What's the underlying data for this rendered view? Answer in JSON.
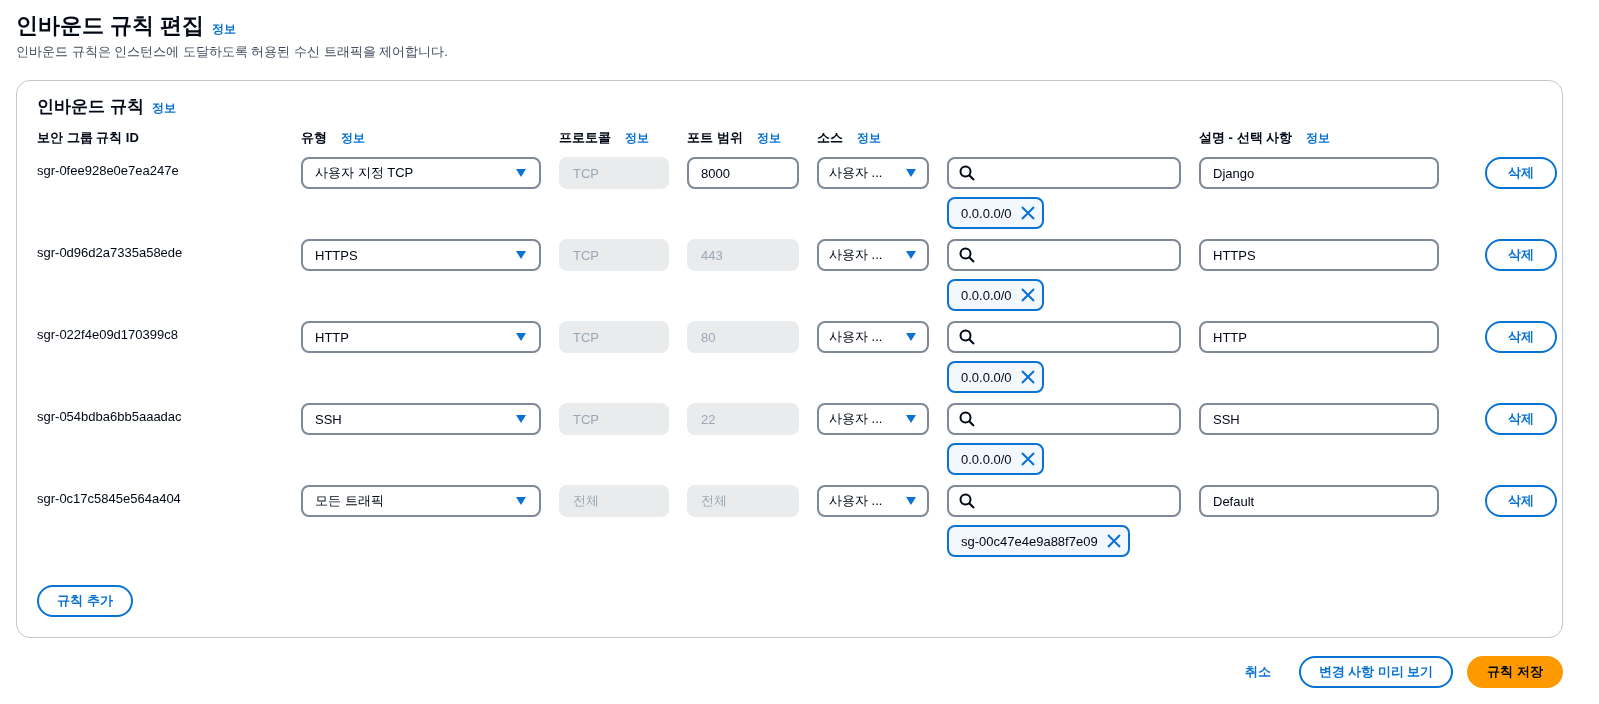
{
  "page": {
    "title": "인바운드 규칙 편집",
    "info": "정보",
    "description": "인바운드 규칙은 인스턴스에 도달하도록 허용된 수신 트래픽을 제어합니다."
  },
  "card": {
    "title": "인바운드 규칙",
    "info": "정보"
  },
  "columns": [
    {
      "label": "보안 그룹 규칙 ID"
    },
    {
      "label": "유형",
      "info": "정보"
    },
    {
      "label": "프로토콜",
      "info": "정보"
    },
    {
      "label": "포트 범위",
      "info": "정보"
    },
    {
      "label": "소스",
      "info": "정보"
    },
    {
      "label": "설명 - 선택 사항",
      "info": "정보"
    }
  ],
  "rules": [
    {
      "id": "sgr-0fee928e0e7ea247e",
      "type": "사용자 지정 TCP",
      "protocol": {
        "value": "TCP",
        "disabled": true
      },
      "port": {
        "value": "8000",
        "disabled": false
      },
      "source": "사용자 ...",
      "chips": [
        "0.0.0.0/0"
      ],
      "description": "Django",
      "delete": "삭제"
    },
    {
      "id": "sgr-0d96d2a7335a58ede",
      "type": "HTTPS",
      "protocol": {
        "value": "TCP",
        "disabled": true
      },
      "port": {
        "value": "443",
        "disabled": true
      },
      "source": "사용자 ...",
      "chips": [
        "0.0.0.0/0"
      ],
      "description": "HTTPS",
      "delete": "삭제"
    },
    {
      "id": "sgr-022f4e09d170399c8",
      "type": "HTTP",
      "protocol": {
        "value": "TCP",
        "disabled": true
      },
      "port": {
        "value": "80",
        "disabled": true
      },
      "source": "사용자 ...",
      "chips": [
        "0.0.0.0/0"
      ],
      "description": "HTTP",
      "delete": "삭제"
    },
    {
      "id": "sgr-054bdba6bb5aaadac",
      "type": "SSH",
      "protocol": {
        "value": "TCP",
        "disabled": true
      },
      "port": {
        "value": "22",
        "disabled": true
      },
      "source": "사용자 ...",
      "chips": [
        "0.0.0.0/0"
      ],
      "description": "SSH",
      "delete": "삭제"
    },
    {
      "id": "sgr-0c17c5845e564a404",
      "type": "모든 트래픽",
      "protocol": {
        "value": "전체",
        "disabled": true
      },
      "port": {
        "value": "전체",
        "disabled": true
      },
      "source": "사용자 ...",
      "chips": [
        "sg-00c47e4e9a88f7e09"
      ],
      "description": "Default",
      "delete": "삭제"
    }
  ],
  "add_button": "규칙 추가",
  "footer": {
    "cancel": "취소",
    "preview": "변경 사항 미리 보기",
    "save": "규칙 저장"
  }
}
